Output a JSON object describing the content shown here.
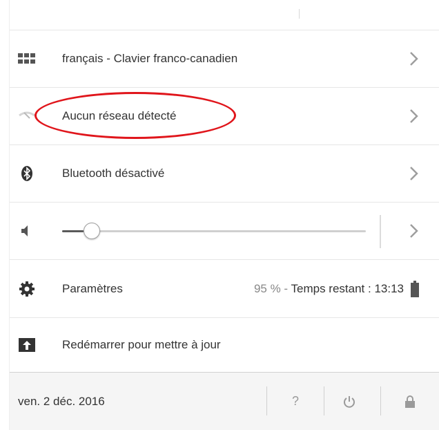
{
  "tray": {
    "ime": {
      "label": "français - Clavier franco-canadien",
      "icon": "keyboard-icon"
    },
    "network": {
      "label": "Aucun réseau détecté",
      "icon": "wifi-off-icon"
    },
    "bluetooth": {
      "label": "Bluetooth désactivé",
      "icon": "bluetooth-icon"
    },
    "volume": {
      "icon": "speaker-icon",
      "level": 0.07
    },
    "settings": {
      "label": "Paramètres",
      "icon": "gear-icon",
      "battery_percent": "95 %",
      "battery_separator": " - ",
      "battery_time": "Temps restant : 13:13",
      "battery_icon": "battery-icon"
    },
    "update": {
      "label": "Redémarrer pour mettre à jour",
      "icon": "update-icon"
    }
  },
  "footer": {
    "date": "ven. 2 déc. 2016",
    "help_label": "?",
    "power_icon": "power-icon",
    "lock_icon": "lock-icon"
  },
  "colors": {
    "text": "#333333",
    "muted": "#888888",
    "highlight": "#e0151b",
    "footer_bg": "#f5f5f5"
  }
}
